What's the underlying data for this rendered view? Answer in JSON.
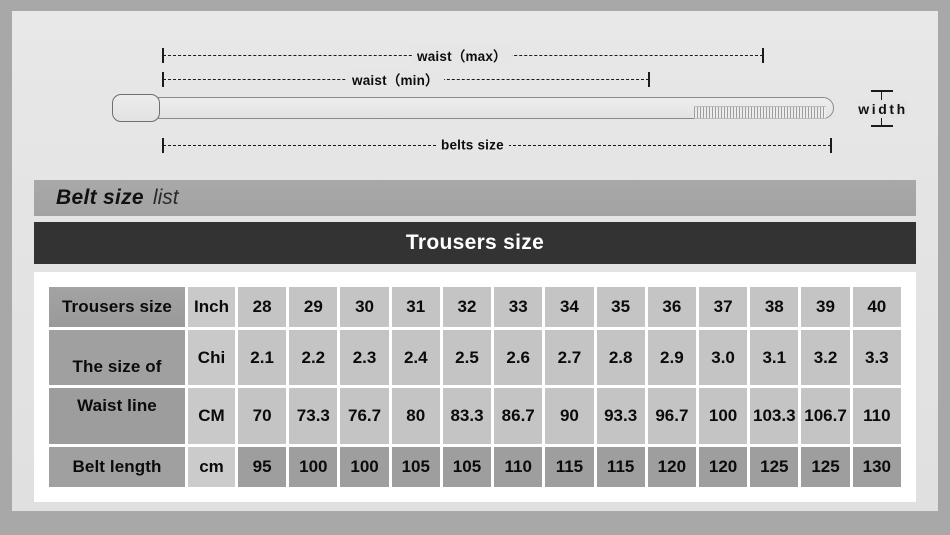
{
  "diagram": {
    "measures": [
      {
        "key": "waist_max",
        "label": "waist（max）"
      },
      {
        "key": "waist_min",
        "label": "waist（min）"
      },
      {
        "key": "belts_size",
        "label": "belts size"
      }
    ],
    "width_label": "width",
    "belt": {
      "buckle": "belt-buckle",
      "strap": "belt-strap",
      "holes": "belt-holes"
    }
  },
  "list_bar": {
    "title_bold": "Belt size",
    "title_light": "list"
  },
  "banner": {
    "title": "Trousers size"
  },
  "table": {
    "rows": [
      {
        "label": "Trousers size",
        "unit": "Inch",
        "values": [
          "28",
          "29",
          "30",
          "31",
          "32",
          "33",
          "34",
          "35",
          "36",
          "37",
          "38",
          "39",
          "40"
        ],
        "dark": false
      },
      {
        "label": "The size of",
        "unit": "Chi",
        "values": [
          "2.1",
          "2.2",
          "2.3",
          "2.4",
          "2.5",
          "2.6",
          "2.7",
          "2.8",
          "2.9",
          "3.0",
          "3.1",
          "3.2",
          "3.3"
        ],
        "dark": false
      },
      {
        "label": "Waist line",
        "unit": "CM",
        "values": [
          "70",
          "73.3",
          "76.7",
          "80",
          "83.3",
          "86.7",
          "90",
          "93.3",
          "96.7",
          "100",
          "103.3",
          "106.7",
          "110"
        ],
        "dark": false
      },
      {
        "label": "Belt length",
        "unit": "cm",
        "values": [
          "95",
          "100",
          "100",
          "105",
          "105",
          "110",
          "115",
          "115",
          "120",
          "120",
          "125",
          "125",
          "130"
        ],
        "dark": true
      }
    ]
  },
  "colors": {
    "frame": "#a8a8a8",
    "panel": "#e4e4e4",
    "list_bar": "#a5a5a5",
    "banner": "#333333",
    "table_bg": "#ffffff",
    "label_cell": "#9d9d9d",
    "unit_cell": "#c9c9c9",
    "value_cell": "#c4c4c4",
    "value_cell_dark": "#9e9e9e",
    "ink": "#111111"
  }
}
